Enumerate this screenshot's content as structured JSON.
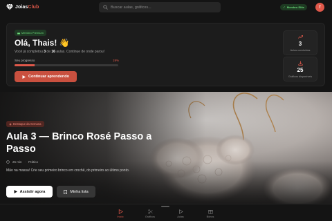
{
  "header": {
    "logo_main": "Joias",
    "logo_accent": "Club",
    "search_placeholder": "Buscar aulas, gráficos...",
    "membership_badge": "Membro Elite",
    "avatar_initial": "T"
  },
  "welcome": {
    "badge": "Membro Premium",
    "greeting": "Olá, Thais! 👋",
    "subtext_prefix": "Você já completou ",
    "completed": "3",
    "subtext_mid": " de ",
    "total": "16",
    "subtext_suffix": " aulas. Continue de onde parou!",
    "progress_label": "Seu progresso",
    "progress_text": "19%",
    "progress_value": 0.19,
    "continue_label": "Continuar aprendendo"
  },
  "stats": [
    {
      "icon": "trending-up-icon",
      "value": "3",
      "label": "Aulas concluídas"
    },
    {
      "icon": "download-icon",
      "value": "25",
      "label": "Gráficos disponíveis"
    }
  ],
  "hero": {
    "badge": "Destaque da Semana",
    "title": "Aula 3 — Brinco Rosé Passo a Passo",
    "duration": "25 min",
    "level": "Prático",
    "description": "Mão na massa! Crie seu primeiro brinco em crochê, do primeiro ao último ponto.",
    "watch_label": "Assistir agora",
    "list_label": "Minha lista"
  },
  "nav": [
    {
      "icon": "home-icon",
      "label": "Início",
      "active": true
    },
    {
      "icon": "scissors-icon",
      "label": "Gráficos",
      "active": false
    },
    {
      "icon": "play-icon",
      "label": "Aulas",
      "active": false
    },
    {
      "icon": "gift-icon",
      "label": "Bônus",
      "active": false
    }
  ],
  "colors": {
    "accent": "#e0584a",
    "success": "#6bd97a",
    "background": "#141414",
    "card": "#1c1c1c"
  }
}
